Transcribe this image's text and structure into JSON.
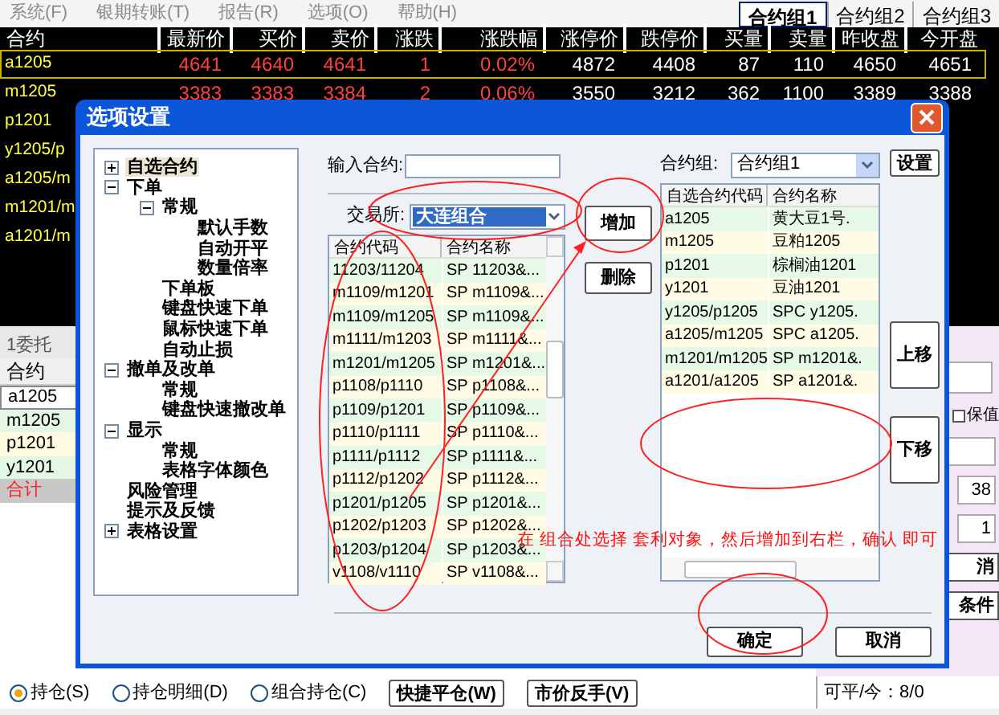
{
  "menu": [
    "系统(F)",
    "银期转账(T)",
    "报告(R)",
    "选项(O)",
    "帮助(H)"
  ],
  "group_tabs": [
    {
      "label": "合约组1",
      "selected": true
    },
    {
      "label": "合约组2",
      "selected": false
    },
    {
      "label": "合约组3",
      "selected": false
    }
  ],
  "quotes": {
    "columns": [
      "合约",
      "最新价",
      "买价",
      "卖价",
      "涨跌",
      "涨跌幅",
      "涨停价",
      "跌停价",
      "买量",
      "卖量",
      "昨收盘",
      "今开盘"
    ],
    "rows": [
      {
        "selected": true,
        "cells": [
          "a1205",
          "4641",
          "4640",
          "4641",
          "1",
          "0.02%",
          "4872",
          "4408",
          "87",
          "110",
          "4650",
          "4651"
        ]
      },
      {
        "selected": false,
        "cells": [
          "m1205",
          "3383",
          "3383",
          "3384",
          "2",
          "0.06%",
          "3550",
          "3212",
          "362",
          "1100",
          "3389",
          "3388"
        ]
      },
      {
        "selected": false,
        "cells": [
          "p1201"
        ]
      },
      {
        "selected": false,
        "cells": [
          "y1205/p"
        ]
      },
      {
        "selected": false,
        "cells": [
          "a1205/m"
        ]
      },
      {
        "selected": false,
        "cells": [
          "m1201/m"
        ]
      },
      {
        "selected": false,
        "cells": [
          "a1201/m"
        ]
      }
    ]
  },
  "orders": {
    "tab": "1委托",
    "header": "合约",
    "rows": [
      {
        "code": "a1205",
        "kind": "selected"
      },
      {
        "code": "m1205",
        "kind": "even"
      },
      {
        "code": "p1201",
        "kind": "odd"
      },
      {
        "code": "y1201",
        "kind": "even"
      },
      {
        "code": "合计",
        "kind": "total"
      }
    ]
  },
  "side_panel": {
    "hedge_label": "保值",
    "hedge_checked": false,
    "spin_values": [
      "38",
      "1"
    ],
    "buttons": [
      "消",
      "条件"
    ],
    "closable": "可平/今：8/0"
  },
  "bottom_bar": {
    "radios": [
      {
        "label": "持仓(S)",
        "selected": true
      },
      {
        "label": "持仓明细(D)",
        "selected": false
      },
      {
        "label": "组合持仓(C)",
        "selected": false
      }
    ],
    "buttons": [
      "快捷平仓(W)",
      "市价反手(V)"
    ]
  },
  "dialog": {
    "title": "选项设置",
    "tree": [
      {
        "label": "自选合约",
        "expanded": false,
        "selected": true
      },
      {
        "label": "下单",
        "expanded": true,
        "selected": false,
        "children": [
          {
            "label": "常规",
            "expanded": true,
            "selected": false,
            "children": [
              {
                "label": "默认手数",
                "selected": false
              },
              {
                "label": "自动开平",
                "selected": false
              },
              {
                "label": "数量倍率",
                "selected": false
              }
            ]
          },
          {
            "label": "下单板",
            "selected": false
          },
          {
            "label": "键盘快速下单",
            "selected": false
          },
          {
            "label": "鼠标快速下单",
            "selected": false
          },
          {
            "label": "自动止损",
            "selected": false
          }
        ]
      },
      {
        "label": "撤单及改单",
        "expanded": true,
        "selected": false,
        "children": [
          {
            "label": "常规",
            "selected": false
          },
          {
            "label": "键盘快速撤改单",
            "selected": false
          }
        ]
      },
      {
        "label": "显示",
        "expanded": true,
        "selected": false,
        "children": [
          {
            "label": "常规",
            "selected": false
          },
          {
            "label": "表格字体颜色",
            "selected": false
          }
        ]
      },
      {
        "label": "风险管理",
        "selected": false
      },
      {
        "label": "提示及反馈",
        "selected": false
      },
      {
        "label": "表格设置",
        "expanded": false,
        "selected": false
      }
    ],
    "input_label": "输入合约:",
    "exchange_label": "交易所:",
    "exchange_value": "大连组合",
    "available": {
      "columns": [
        "合约代码",
        "合约名称"
      ],
      "rows": [
        {
          "code": "11203/11204",
          "name": "SP 11203&..."
        },
        {
          "code": "m1109/m1201",
          "name": "SP m1109&..."
        },
        {
          "code": "m1109/m1205",
          "name": "SP m1109&..."
        },
        {
          "code": "m1111/m1203",
          "name": "SP m1111&..."
        },
        {
          "code": "m1201/m1205",
          "name": "SP m1201&..."
        },
        {
          "code": "p1108/p1110",
          "name": "SP p1108&..."
        },
        {
          "code": "p1109/p1201",
          "name": "SP p1109&..."
        },
        {
          "code": "p1110/p1111",
          "name": "SP p1110&..."
        },
        {
          "code": "p1111/p1112",
          "name": "SP p1111&..."
        },
        {
          "code": "p1112/p1202",
          "name": "SP p1112&..."
        },
        {
          "code": "p1201/p1205",
          "name": "SP p1201&..."
        },
        {
          "code": "p1202/p1203",
          "name": "SP p1202&..."
        },
        {
          "code": "p1203/p1204",
          "name": "SP p1203&..."
        },
        {
          "code": "v1108/v1110",
          "name": "SP v1108&..."
        }
      ]
    },
    "add_buttons": [
      "增加",
      "删除"
    ],
    "group_label": "合约组:",
    "group_value": "合约组1",
    "set_button": "设置",
    "selected_list": {
      "columns": [
        "自选合约代码",
        "合约名称"
      ],
      "rows": [
        {
          "code": "a1205",
          "name": "黄大豆1号."
        },
        {
          "code": "m1205",
          "name": "豆粕1205"
        },
        {
          "code": "p1201",
          "name": "棕榈油1201"
        },
        {
          "code": "y1201",
          "name": "豆油1201"
        },
        {
          "code": "y1205/p1205",
          "name": "SPC y1205."
        },
        {
          "code": "a1205/m1205",
          "name": "SPC a1205."
        },
        {
          "code": "m1201/m1205",
          "name": "SP m1201&."
        },
        {
          "code": "a1201/a1205",
          "name": "SP a1201&."
        }
      ]
    },
    "move_buttons": [
      "上移",
      "下移"
    ],
    "ok": "确定",
    "cancel": "取消"
  },
  "annotation": {
    "text": "在 组合处选择 套利对象，然后增加到右栏，确认 即可"
  }
}
